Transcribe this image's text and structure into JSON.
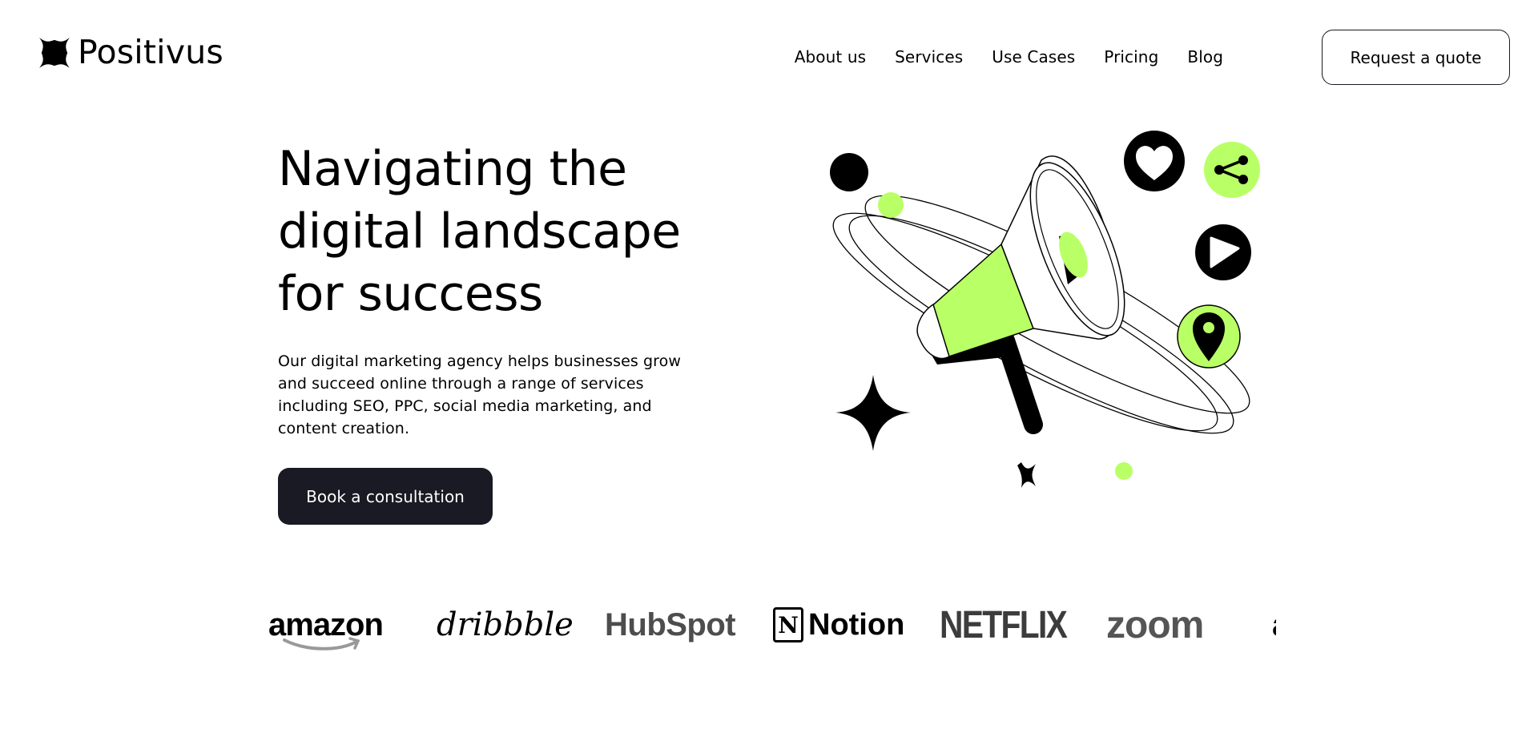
{
  "brand": {
    "name": "Positivus",
    "accent": "#b9ff66",
    "dark": "#191a23"
  },
  "nav": {
    "items": [
      "About us",
      "Services",
      "Use Cases",
      "Pricing",
      "Blog"
    ],
    "cta_label": "Request a quote"
  },
  "hero": {
    "title": "Navigating the digital landscape for success",
    "description": "Our digital marketing agency helps businesses grow and succeed online through a range of services including SEO, PPC, social media marketing, and content creation.",
    "cta_label": "Book a consultation"
  },
  "illustration_icons": [
    "megaphone-icon",
    "heart-icon",
    "share-icon",
    "play-icon",
    "location-pin-icon",
    "sparkle-star-icon"
  ],
  "client_logos": [
    {
      "name": "amazon",
      "text": "amazon"
    },
    {
      "name": "dribbble",
      "text": "dribbble"
    },
    {
      "name": "hubspot",
      "text": "HubSpot"
    },
    {
      "name": "notion",
      "text": "Notion",
      "mark": "N"
    },
    {
      "name": "netflix",
      "text": "NETFLIX"
    },
    {
      "name": "zoom",
      "text": "zoom"
    }
  ]
}
